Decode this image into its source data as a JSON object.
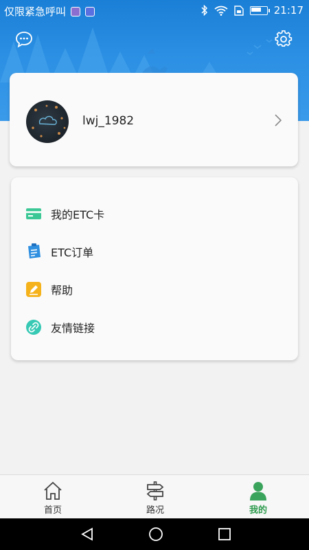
{
  "status_bar": {
    "carrier_text": "仅限紧急呼叫",
    "time": "21:17",
    "battery_level": 0.7
  },
  "header": {
    "left_icon": "chat-bubble-icon",
    "right_icon": "gear-icon"
  },
  "user": {
    "username": "lwj_1982"
  },
  "menu": {
    "items": [
      {
        "label": "我的ETC卡",
        "icon": "card-icon",
        "color": "#3cc896"
      },
      {
        "label": "ETC订单",
        "icon": "clipboard-icon",
        "color": "#2f8fe0"
      },
      {
        "label": "帮助",
        "icon": "pencil-icon",
        "color": "#f5b21b"
      },
      {
        "label": "友情链接",
        "icon": "link-icon",
        "color": "#37c9b4"
      }
    ]
  },
  "bottom_nav": {
    "items": [
      {
        "label": "首页",
        "icon": "home-icon",
        "active": false
      },
      {
        "label": "路况",
        "icon": "signpost-icon",
        "active": false
      },
      {
        "label": "我的",
        "icon": "person-icon",
        "active": true
      }
    ]
  },
  "colors": {
    "header_blue": "#2b8fe3",
    "active_green": "#2e9b4e"
  }
}
